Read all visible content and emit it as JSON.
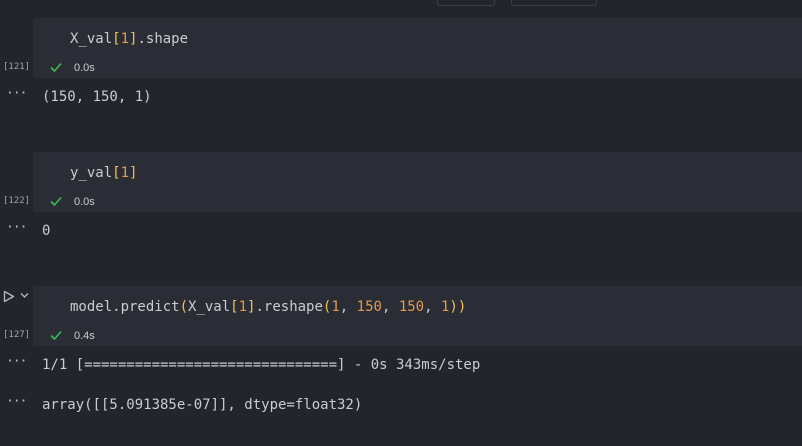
{
  "cells": [
    {
      "count": "[121]",
      "code": {
        "name": "X_val",
        "b1": "[",
        "idx": "1",
        "b2": "]",
        "rest": ".shape"
      },
      "status": "0.0s",
      "output": "(150, 150, 1)"
    },
    {
      "count": "[122]",
      "code": {
        "name": "y_val",
        "b1": "[",
        "idx": "1",
        "b2": "]"
      },
      "status": "0.0s",
      "output": "0"
    },
    {
      "count": "[127]",
      "code": {
        "t1": "model.predict",
        "p1": "(",
        "t2": "X_val",
        "b1": "[",
        "idx": "1",
        "b2": "]",
        "t3": ".reshape",
        "p2": "(",
        "a1": "1",
        "c1": ", ",
        "a2": "150",
        "c2": ", ",
        "a3": "150",
        "c3": ", ",
        "a4": "1",
        "p3": ")",
        "p4": ")"
      },
      "status": "0.4s",
      "output_progress": "1/1 [==============================] - 0s 343ms/step",
      "output_result": "array([[5.091385e-07]], dtype=float32)"
    }
  ],
  "icons": {
    "check": "check-icon",
    "more": "more-icon",
    "run": "run-icon",
    "chevron": "chevron-down-icon"
  },
  "colors": {
    "background": "#22252c",
    "cell_background": "#2a2d35",
    "check_green": "#3fb950",
    "bracket_yellow": "#f2c14e",
    "number_orange": "#e39a4a"
  }
}
